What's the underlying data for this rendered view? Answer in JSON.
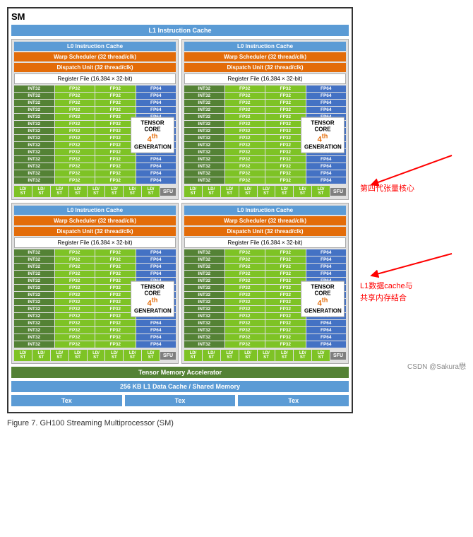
{
  "sm_title": "SM",
  "l1_instruction_cache": "L1 Instruction Cache",
  "quadrants": [
    {
      "l0_cache": "L0 Instruction Cache",
      "warp_scheduler": "Warp Scheduler (32 thread/clk)",
      "dispatch_unit": "Dispatch Unit (32 thread/clk)",
      "register_file": "Register File (16,384 × 32-bit)",
      "tensor_core_gen": "4",
      "tensor_core_label": "TENSOR CORE",
      "tensor_core_generation": "GENERATION"
    },
    {
      "l0_cache": "L0 Instruction Cache",
      "warp_scheduler": "Warp Scheduler (32 thread/clk)",
      "dispatch_unit": "Dispatch Unit (32 thread/clk)",
      "register_file": "Register File (16,384 × 32-bit)",
      "tensor_core_gen": "4",
      "tensor_core_label": "TENSOR CORE",
      "tensor_core_generation": "GENERATION"
    },
    {
      "l0_cache": "L0 Instruction Cache",
      "warp_scheduler": "Warp Scheduler (32 thread/clk)",
      "dispatch_unit": "Dispatch Unit (32 thread/clk)",
      "register_file": "Register File (16,384 × 32-bit)",
      "tensor_core_gen": "4",
      "tensor_core_label": "TENSOR CORE",
      "tensor_core_generation": "GENERATION"
    },
    {
      "l0_cache": "L0 Instruction Cache",
      "warp_scheduler": "Warp Scheduler (32 thread/clk)",
      "dispatch_unit": "Dispatch Unit (32 thread/clk)",
      "register_file": "Register File (16,384 × 32-bit)",
      "tensor_core_gen": "4",
      "tensor_core_label": "TENSOR CORE",
      "tensor_core_generation": "GENERATION"
    }
  ],
  "tensor_memory_accelerator": "Tensor Memory Accelerator",
  "l1_data_cache": "256 KB L1 Data Cache / Shared Memory",
  "tex_label": "Tex",
  "figure_caption": "Figure 7.    GH100 Streaming Multiprocessor (SM)",
  "csdn_credit": "CSDN @Sakura懋",
  "annotation1_line1": "第四代张量核心",
  "annotation2_line1": "L1数据cache与",
  "annotation2_line2": "共享内存结合",
  "rows": [
    "INT32",
    "FP32",
    "FP32",
    "FP64"
  ],
  "num_cuda_rows": 14,
  "sfu_label": "SFU",
  "ldst_label": "LD/\nST"
}
